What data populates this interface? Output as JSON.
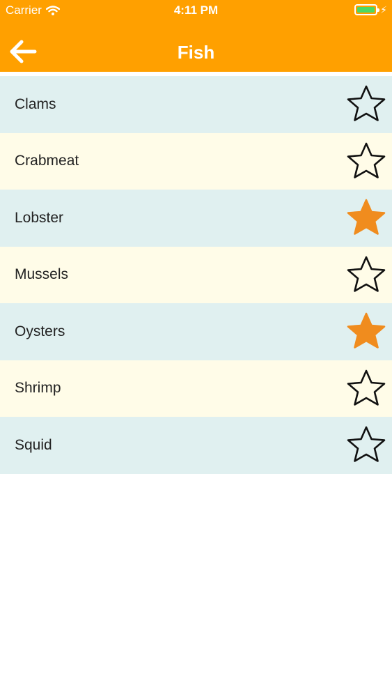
{
  "status_bar": {
    "carrier": "Carrier",
    "time": "4:11 PM",
    "battery_color": "#4CD964",
    "icons": [
      "wifi-icon",
      "battery-icon",
      "charging-bolt-icon"
    ]
  },
  "nav": {
    "title": "Fish",
    "back_icon": "arrow-left-icon"
  },
  "colors": {
    "accent": "#FFA000",
    "row_blue": "#E0F0F0",
    "row_cream": "#FFFCE8",
    "star_filled": "#F08C1E",
    "star_outline": "#111111"
  },
  "items": [
    {
      "label": "Clams",
      "favorite": false
    },
    {
      "label": "Crabmeat",
      "favorite": false
    },
    {
      "label": "Lobster",
      "favorite": true
    },
    {
      "label": "Mussels",
      "favorite": false
    },
    {
      "label": "Oysters",
      "favorite": true
    },
    {
      "label": "Shrimp",
      "favorite": false
    },
    {
      "label": "Squid",
      "favorite": false
    }
  ]
}
